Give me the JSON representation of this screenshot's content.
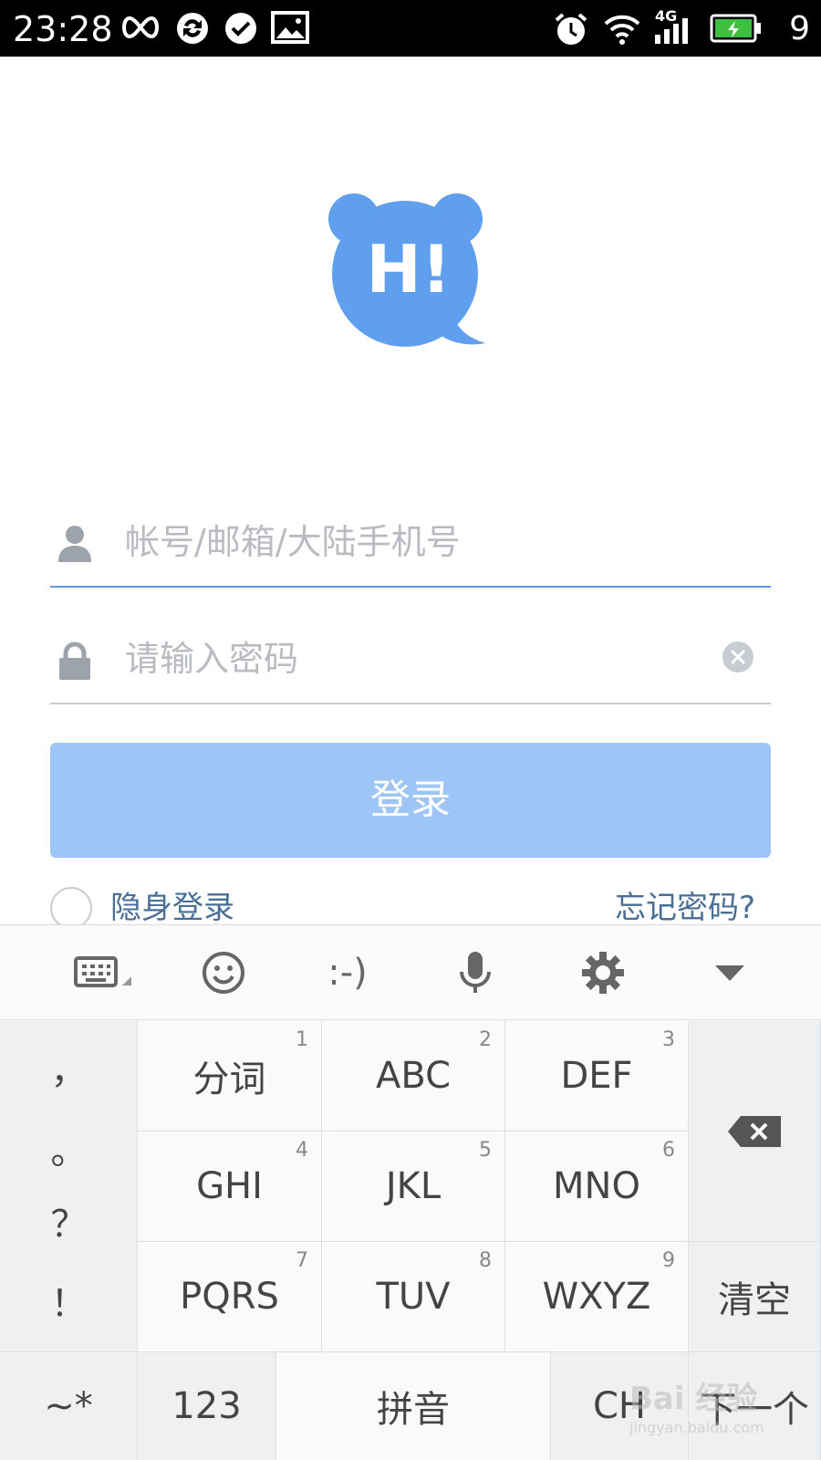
{
  "status_bar": {
    "time": "23:28",
    "battery_level": "9",
    "network": "4G",
    "icons": [
      "infinity-icon",
      "sync-icon",
      "check-circle-icon",
      "image-icon",
      "alarm-icon",
      "wifi-icon",
      "signal-icon",
      "battery-icon"
    ]
  },
  "logo": {
    "text": "H!",
    "color": "#5f9fed"
  },
  "login_form": {
    "account_placeholder": "帐号/邮箱/大陆手机号",
    "account_value": "",
    "password_placeholder": "请输入密码",
    "password_value": "",
    "login_button": "登录",
    "invisible_login_label": "隐身登录",
    "invisible_login_checked": false,
    "forgot_password": "忘记密码?"
  },
  "colors": {
    "accent": "#5b9be6",
    "button_bg": "#9dc5f5",
    "link": "#4a6f96"
  },
  "keyboard": {
    "toolbar": {
      "emoticon": ":-)",
      "items": [
        "keyboard-switch-icon",
        "emoji-icon",
        "emoticon",
        "microphone-icon",
        "settings-icon",
        "collapse-icon"
      ]
    },
    "punctuation": [
      "，",
      "。",
      "？",
      "！"
    ],
    "keys": [
      {
        "label": "分词",
        "num": "1"
      },
      {
        "label": "ABC",
        "num": "2"
      },
      {
        "label": "DEF",
        "num": "3"
      },
      {
        "label": "GHI",
        "num": "4"
      },
      {
        "label": "JKL",
        "num": "5"
      },
      {
        "label": "MNO",
        "num": "6"
      },
      {
        "label": "PQRS",
        "num": "7"
      },
      {
        "label": "TUV",
        "num": "8"
      },
      {
        "label": "WXYZ",
        "num": "9"
      }
    ],
    "clear": "清空",
    "bottom_row": {
      "symbols": "~*",
      "numbers": "123",
      "pinyin": "拼音",
      "language": "CH",
      "next": "下一个"
    }
  },
  "watermark": {
    "text": "Bai 经验",
    "subtext": "jingyan.baidu.com"
  }
}
